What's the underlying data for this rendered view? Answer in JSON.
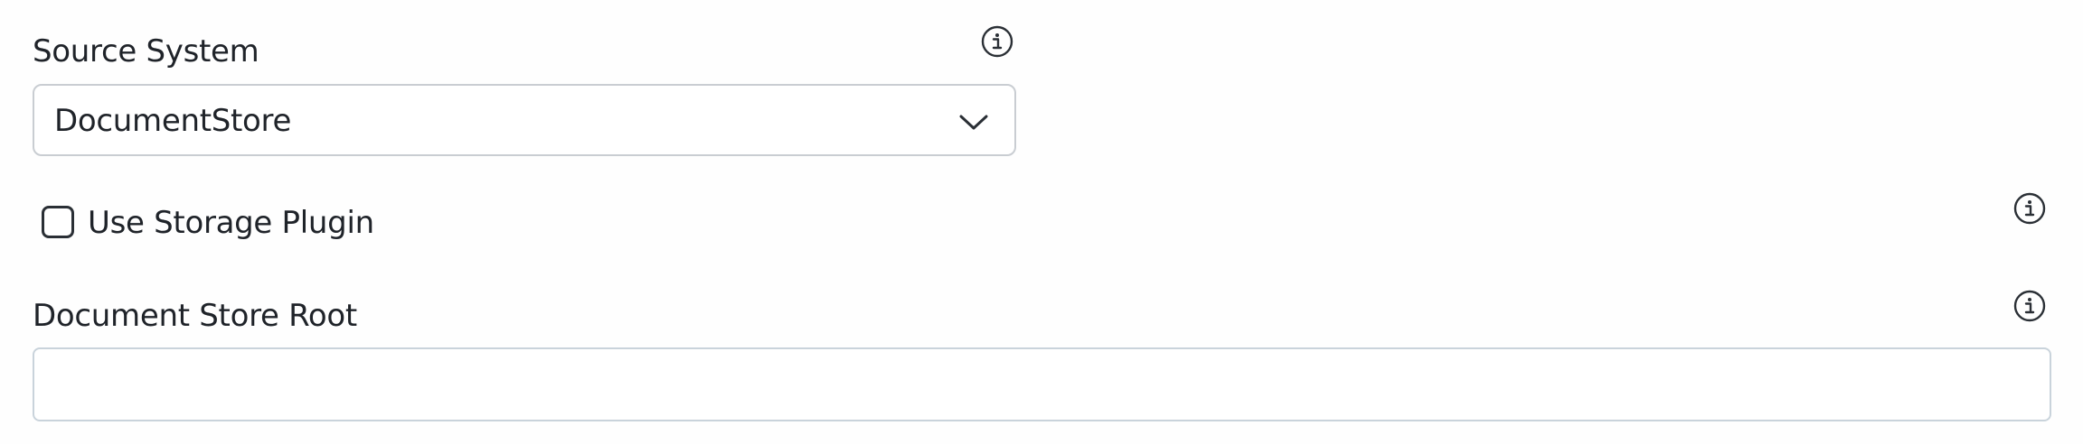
{
  "source_system": {
    "label": "Source System",
    "selected_value": "DocumentStore",
    "info_icon": "info-icon",
    "dropdown_icon": "chevron-down-icon"
  },
  "use_storage_plugin": {
    "label": "Use Storage Plugin",
    "checked": false,
    "info_icon": "info-icon"
  },
  "document_store_root": {
    "label": "Document Store Root",
    "value": "",
    "placeholder": "",
    "info_icon": "info-icon"
  }
}
